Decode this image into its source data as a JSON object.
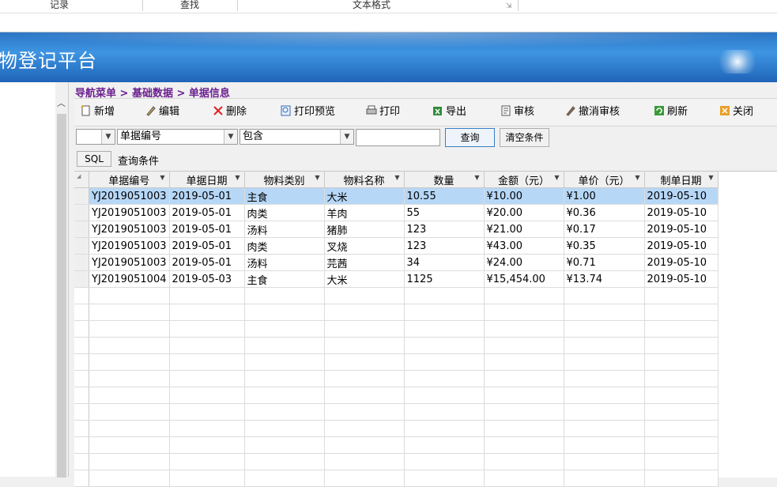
{
  "ribbon": {
    "groups": [
      "记录",
      "查找",
      "文本格式"
    ]
  },
  "banner": {
    "title": "物登记平台"
  },
  "breadcrumb": "导航菜单 > 基础数据 > 单据信息",
  "toolbar": {
    "buttons": [
      {
        "label": "新增",
        "icon": "new-doc-icon"
      },
      {
        "label": "编辑",
        "icon": "edit-icon"
      },
      {
        "label": "删除",
        "icon": "delete-x-icon"
      },
      {
        "label": "打印预览",
        "icon": "print-preview-icon"
      },
      {
        "label": "打印",
        "icon": "printer-icon"
      },
      {
        "label": "导出",
        "icon": "export-excel-icon"
      },
      {
        "label": "审核",
        "icon": "approve-icon"
      },
      {
        "label": "撤消审核",
        "icon": "unapprove-icon"
      },
      {
        "label": "刷新",
        "icon": "refresh-icon"
      },
      {
        "label": "关闭",
        "icon": "close-icon"
      }
    ]
  },
  "filter": {
    "logic_value": "",
    "field_value": "单据编号",
    "operator_value": "包含",
    "search_value": "",
    "query_label": "查询",
    "clear_label": "清空条件"
  },
  "sql": {
    "button_label": "SQL",
    "label": "查询条件"
  },
  "grid": {
    "columns": [
      "单据编号",
      "单据日期",
      "物料类别",
      "物料名称",
      "数量",
      "金额（元）",
      "单价（元）",
      "制单日期"
    ],
    "rows": [
      [
        "YJ2019051003",
        "2019-05-01",
        "主食",
        "大米",
        "10.55",
        "¥10.00",
        "¥1.00",
        "2019-05-10"
      ],
      [
        "YJ2019051003",
        "2019-05-01",
        "肉类",
        "羊肉",
        "55",
        "¥20.00",
        "¥0.36",
        "2019-05-10"
      ],
      [
        "YJ2019051003",
        "2019-05-01",
        "汤料",
        "猪肺",
        "123",
        "¥21.00",
        "¥0.17",
        "2019-05-10"
      ],
      [
        "YJ2019051003",
        "2019-05-01",
        "肉类",
        "叉烧",
        "123",
        "¥43.00",
        "¥0.35",
        "2019-05-10"
      ],
      [
        "YJ2019051003",
        "2019-05-01",
        "汤料",
        "芫茜",
        "34",
        "¥24.00",
        "¥0.71",
        "2019-05-10"
      ],
      [
        "YJ2019051004",
        "2019-05-03",
        "主食",
        "大米",
        "1125",
        "¥15,454.00",
        "¥13.74",
        "2019-05-10"
      ]
    ],
    "selected_row": 0,
    "colors": {
      "selected": "#b7d7f7",
      "header": "#f0f0f0"
    }
  }
}
